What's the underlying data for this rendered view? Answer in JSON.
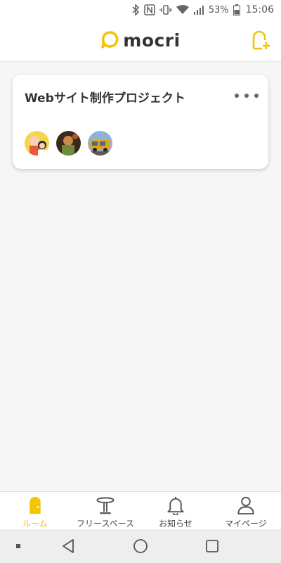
{
  "status_bar": {
    "battery_percent": "53%",
    "time": "15:06",
    "icons": [
      "bluetooth-icon",
      "nfc-icon",
      "vibrate-icon",
      "wifi-icon",
      "signal-icon",
      "battery-icon"
    ]
  },
  "header": {
    "logo_text": "mocri",
    "accent_color": "#f3c400",
    "add_room_icon": "add-room-icon"
  },
  "rooms": [
    {
      "title": "Webサイト制作プロジェクト",
      "members": [
        "member-avatar-1",
        "member-avatar-2",
        "member-avatar-3"
      ]
    }
  ],
  "tabs": [
    {
      "label": "ルーム",
      "icon": "door-icon",
      "active": true
    },
    {
      "label": "フリースペース",
      "icon": "table-icon",
      "active": false
    },
    {
      "label": "お知らせ",
      "icon": "bell-icon",
      "active": false
    },
    {
      "label": "マイページ",
      "icon": "person-icon",
      "active": false
    }
  ],
  "system_nav": [
    "dot-icon",
    "back-icon",
    "home-icon",
    "recents-icon"
  ]
}
